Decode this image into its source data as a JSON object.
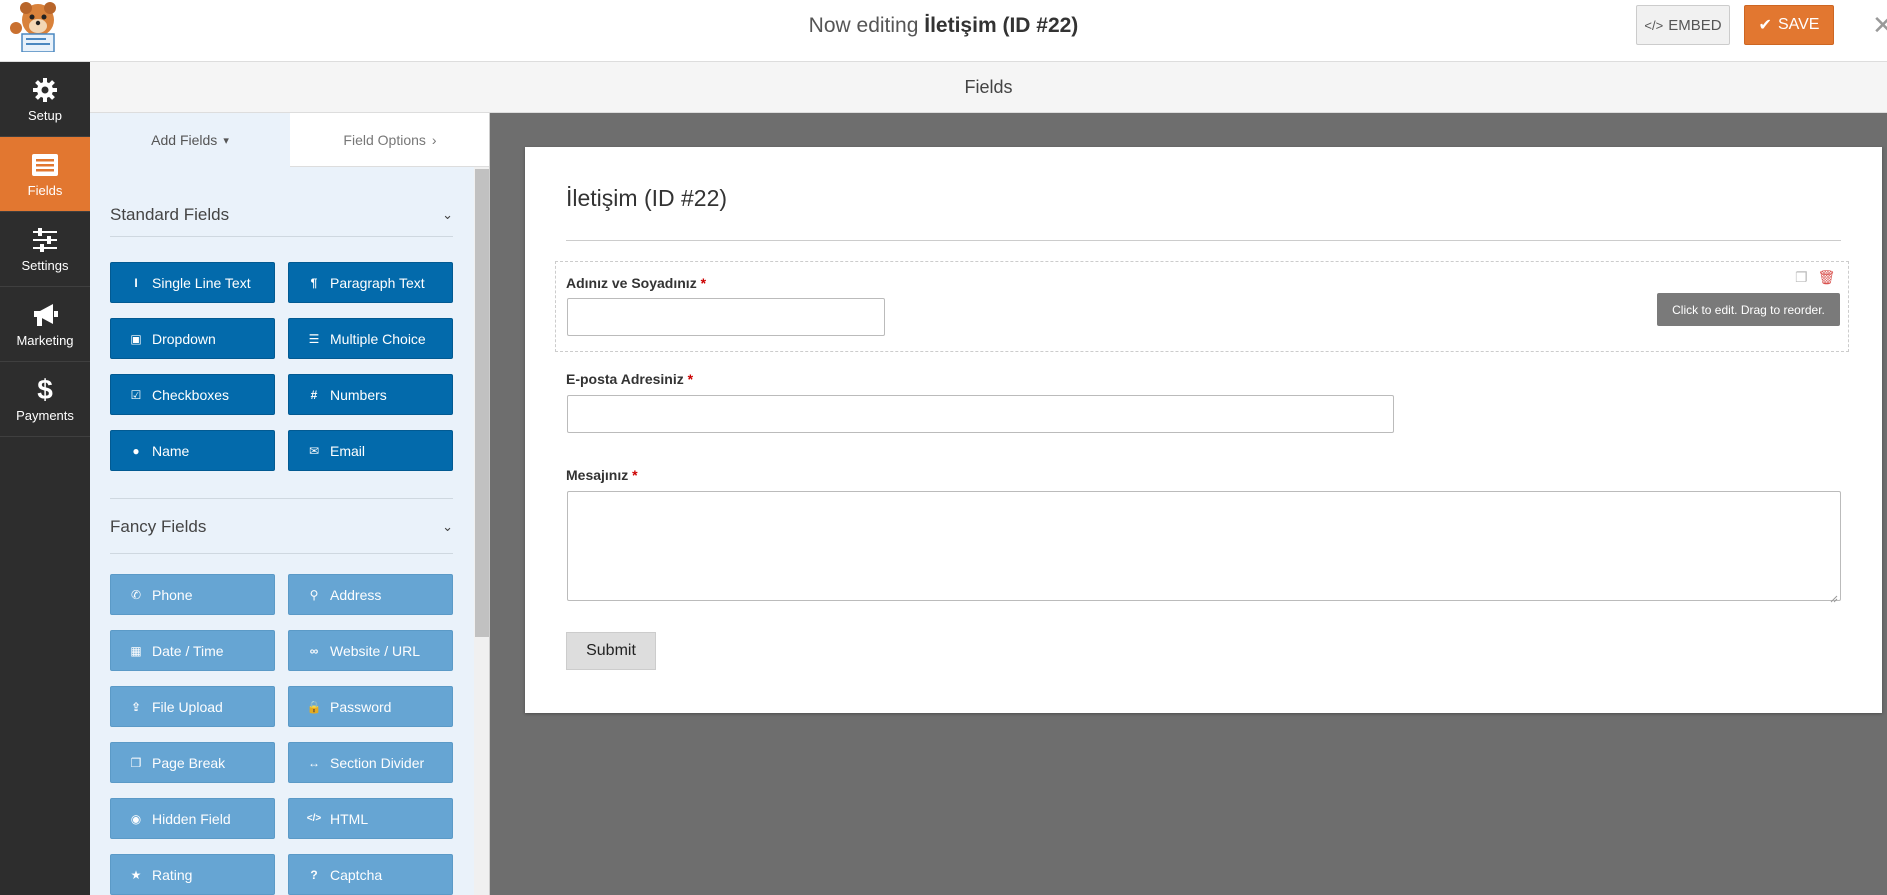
{
  "topbar": {
    "title_prefix": "Now editing",
    "title_form": "İletişim (ID #22)",
    "embed_label": "EMBED",
    "save_label": "SAVE",
    "close_glyph": "✕"
  },
  "nav": {
    "items": [
      {
        "label": "Setup",
        "icon": "gear-icon",
        "active": false
      },
      {
        "label": "Fields",
        "icon": "list-icon",
        "active": true
      },
      {
        "label": "Settings",
        "icon": "sliders-icon",
        "active": false
      },
      {
        "label": "Marketing",
        "icon": "megaphone-icon",
        "active": false
      },
      {
        "label": "Payments",
        "icon": "dollar-icon",
        "active": false
      }
    ]
  },
  "fields_bar": {
    "title": "Fields"
  },
  "panel": {
    "tabs": [
      {
        "label": "Add Fields",
        "chevron": "⌄"
      },
      {
        "label": "Field Options",
        "chevron": "›"
      }
    ],
    "standard": {
      "title": "Standard Fields",
      "buttons": [
        {
          "label": "Single Line Text",
          "icon": "text-cursor-icon"
        },
        {
          "label": "Paragraph Text",
          "icon": "paragraph-icon"
        },
        {
          "label": "Dropdown",
          "icon": "caret-square-icon"
        },
        {
          "label": "Multiple Choice",
          "icon": "list-ul-icon"
        },
        {
          "label": "Checkboxes",
          "icon": "check-square-icon"
        },
        {
          "label": "Numbers",
          "icon": "hashtag-icon"
        },
        {
          "label": "Name",
          "icon": "user-icon"
        },
        {
          "label": "Email",
          "icon": "envelope-icon"
        }
      ]
    },
    "fancy": {
      "title": "Fancy Fields",
      "buttons": [
        {
          "label": "Phone",
          "icon": "phone-icon"
        },
        {
          "label": "Address",
          "icon": "map-marker-icon"
        },
        {
          "label": "Date / Time",
          "icon": "calendar-icon"
        },
        {
          "label": "Website / URL",
          "icon": "link-icon"
        },
        {
          "label": "File Upload",
          "icon": "upload-icon"
        },
        {
          "label": "Password",
          "icon": "lock-icon"
        },
        {
          "label": "Page Break",
          "icon": "copy-icon"
        },
        {
          "label": "Section Divider",
          "icon": "arrows-h-icon"
        },
        {
          "label": "Hidden Field",
          "icon": "eye-slash-icon"
        },
        {
          "label": "HTML",
          "icon": "code-icon"
        },
        {
          "label": "Rating",
          "icon": "star-icon"
        },
        {
          "label": "Captcha",
          "icon": "question-circle-icon"
        }
      ]
    }
  },
  "form": {
    "title": "İletişim (ID #22)",
    "fields": [
      {
        "label": "Adınız ve Soyadınız",
        "required": "*"
      },
      {
        "label": "E-posta Adresiniz",
        "required": "*"
      },
      {
        "label": "Mesajınız",
        "required": "*"
      }
    ],
    "tooltip": "Click to edit. Drag to reorder.",
    "submit_label": "Submit"
  },
  "colors": {
    "accent_orange": "#e27730",
    "nav_bg": "#2d2d2d",
    "standard_button": "#036aab",
    "fancy_button": "#5b9fd0",
    "preview_bg": "#6e6e6e"
  }
}
